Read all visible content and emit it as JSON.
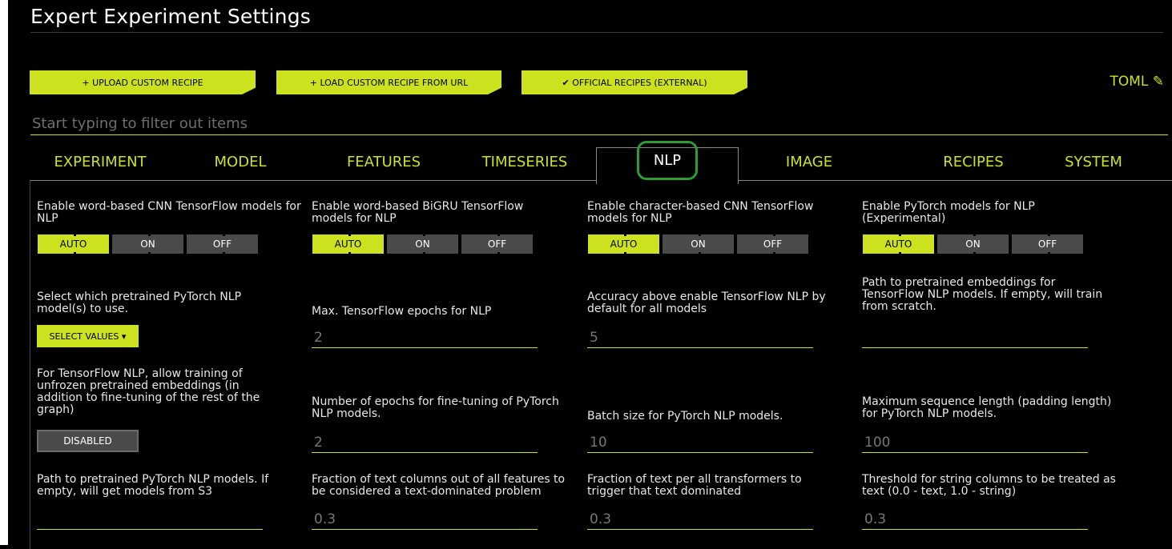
{
  "page": {
    "title": "Expert Experiment Settings"
  },
  "actions": {
    "upload": "+ UPLOAD CUSTOM RECIPE",
    "load_url": "+ LOAD CUSTOM RECIPE FROM URL",
    "official": "✔ OFFICIAL RECIPES (EXTERNAL)",
    "toml": "TOML ✎"
  },
  "filter": {
    "placeholder": "Start typing to filter out items",
    "value": ""
  },
  "tabs": [
    {
      "label": "EXPERIMENT"
    },
    {
      "label": "MODEL"
    },
    {
      "label": "FEATURES"
    },
    {
      "label": "TIMESERIES"
    },
    {
      "label": "NLP",
      "active": true
    },
    {
      "label": "IMAGE"
    },
    {
      "label": "RECIPES"
    },
    {
      "label": "SYSTEM"
    }
  ],
  "toggle_labels": {
    "auto": "AUTO",
    "on": "ON",
    "off": "OFF"
  },
  "settings": {
    "cnn_tf": {
      "label": "Enable word-based CNN TensorFlow models for NLP",
      "value": "AUTO"
    },
    "bigru_tf": {
      "label": "Enable word-based BiGRU TensorFlow models for NLP",
      "value": "AUTO"
    },
    "char_cnn_tf": {
      "label": "Enable character-based CNN TensorFlow models for NLP",
      "value": "AUTO"
    },
    "pytorch_nlp": {
      "label": "Enable PyTorch models for NLP (Experimental)",
      "value": "AUTO"
    },
    "pytorch_models": {
      "label": "Select which pretrained PyTorch NLP model(s) to use.",
      "button": "SELECT VALUES ▾"
    },
    "tf_epochs": {
      "label": "Max. TensorFlow epochs for NLP",
      "value": "2"
    },
    "accuracy_tf": {
      "label": "Accuracy above enable TensorFlow NLP by default for all models",
      "value": "5"
    },
    "embeddings_path": {
      "label": "Path to pretrained embeddings for TensorFlow NLP models. If empty, will train from scratch.",
      "value": ""
    },
    "train_unfrozen": {
      "label": "For TensorFlow NLP, allow training of unfrozen pretrained embeddings (in addition to fine-tuning of the rest of the graph)",
      "value": "DISABLED"
    },
    "pt_epochs": {
      "label": "Number of epochs for fine-tuning of PyTorch NLP models.",
      "value": "2"
    },
    "pt_batch": {
      "label": "Batch size for PyTorch NLP models.",
      "value": "10"
    },
    "pt_maxlen": {
      "label": "Maximum sequence length (padding length) for PyTorch NLP models.",
      "value": "100"
    },
    "pt_models_path": {
      "label": "Path to pretrained PyTorch NLP models. If empty, will get models from S3",
      "value": ""
    },
    "text_frac": {
      "label": "Fraction of text columns out of all features to be considered a text-dominated problem",
      "value": "0.3"
    },
    "text_transformers": {
      "label": "Fraction of text per all transformers to trigger that text dominated",
      "value": "0.3"
    },
    "string_threshold": {
      "label": "Threshold for string columns to be treated as text (0.0 - text, 1.0 - string)",
      "value": "0.3"
    }
  }
}
